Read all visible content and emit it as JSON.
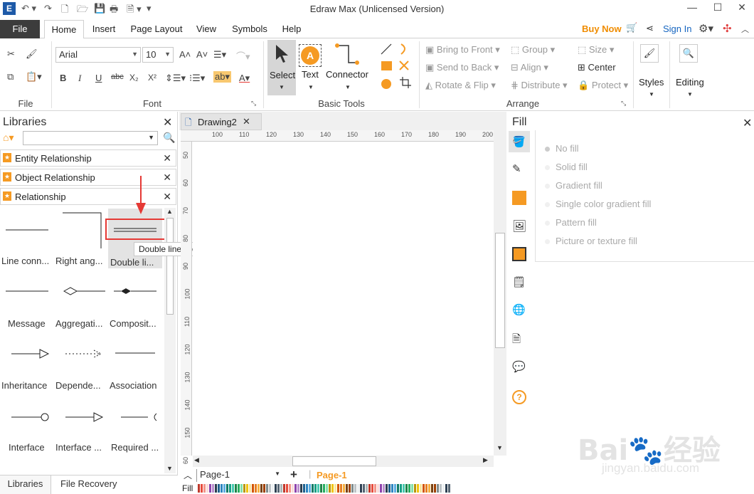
{
  "window": {
    "title": "Edraw Max (Unlicensed Version)"
  },
  "tabs": {
    "file": "File",
    "home": "Home",
    "insert": "Insert",
    "page_layout": "Page Layout",
    "view": "View",
    "symbols": "Symbols",
    "help": "Help"
  },
  "account": {
    "buy_now": "Buy Now",
    "sign_in": "Sign In"
  },
  "ribbon": {
    "file_group": "File",
    "font_group": "Font",
    "font_name": "Arial",
    "font_size": "10",
    "basic_tools_group": "Basic Tools",
    "select": "Select",
    "text": "Text",
    "connector": "Connector",
    "arrange_group": "Arrange",
    "bring_to_front": "Bring to Front",
    "send_to_back": "Send to Back",
    "rotate_flip": "Rotate & Flip",
    "group": "Group",
    "align": "Align",
    "distribute": "Distribute",
    "size": "Size",
    "center": "Center",
    "protect": "Protect",
    "styles": "Styles",
    "editing": "Editing"
  },
  "libraries": {
    "title": "Libraries",
    "categories": [
      "Entity Relationship",
      "Object Relationship",
      "Relationship"
    ],
    "shapes": [
      "Line conn...",
      "Right ang...",
      "Double li...",
      "Message",
      "Aggregati...",
      "Composit...",
      "Inheritance",
      "Depende...",
      "Association",
      "Interface",
      "Interface ...",
      "Required ..."
    ],
    "tooltip": "Double line connector",
    "bottom_tabs": [
      "Libraries",
      "File Recovery"
    ]
  },
  "document": {
    "tab": "Drawing2",
    "ruler_h": [
      "100",
      "110",
      "120",
      "130",
      "140",
      "150",
      "160",
      "170",
      "180",
      "190",
      "200"
    ],
    "ruler_v": [
      "50",
      "60",
      "70",
      "80",
      "90",
      "100",
      "110",
      "120",
      "130",
      "140",
      "150",
      "60"
    ],
    "page_combo": "Page-1",
    "page_tab": "Page-1",
    "fill_label": "Fill"
  },
  "fill_panel": {
    "title": "Fill",
    "options": [
      "No fill",
      "Solid fill",
      "Gradient fill",
      "Single color gradient fill",
      "Pattern fill",
      "Picture or texture fill"
    ]
  },
  "colors": {
    "accent": "#f59a23",
    "highlight_red": "#e53935",
    "link_blue": "#1565c0"
  }
}
